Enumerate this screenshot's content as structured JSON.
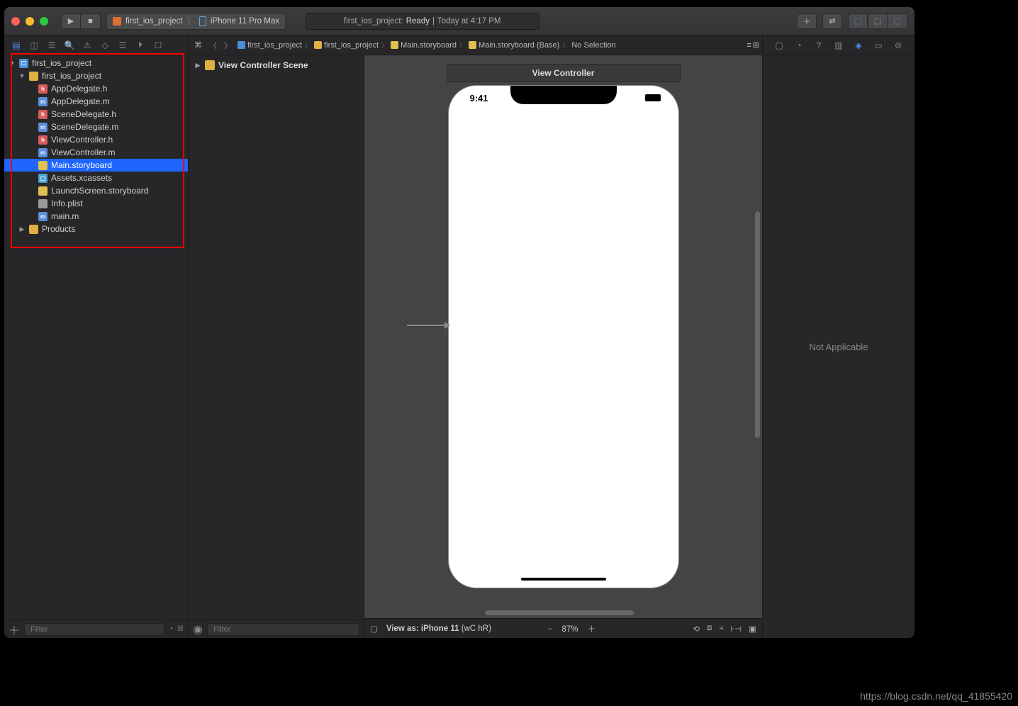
{
  "toolbar": {
    "scheme_project": "first_ios_project",
    "scheme_device": "iPhone 11 Pro Max"
  },
  "status": {
    "project": "first_ios_project:",
    "state": "Ready",
    "sep": " | ",
    "time": "Today at 4:17 PM"
  },
  "jumpbar": {
    "i1": "first_ios_project",
    "i2": "first_ios_project",
    "i3": "Main.storyboard",
    "i4": "Main.storyboard (Base)",
    "i5": "No Selection"
  },
  "navigator": {
    "project": "first_ios_project",
    "group": "first_ios_project",
    "files": {
      "f1": "AppDelegate.h",
      "f2": "AppDelegate.m",
      "f3": "SceneDelegate.h",
      "f4": "SceneDelegate.m",
      "f5": "ViewController.h",
      "f6": "ViewController.m",
      "f7": "Main.storyboard",
      "f8": "Assets.xcassets",
      "f9": "LaunchScreen.storyboard",
      "f10": "Info.plist",
      "f11": "main.m"
    },
    "products": "Products",
    "filter_placeholder": "Filter"
  },
  "outline": {
    "scene": "View Controller Scene",
    "filter_placeholder": "Filter"
  },
  "canvas": {
    "vc_title": "View Controller",
    "statusbar_time": "9:41",
    "footer_viewas_label": "View as: iPhone 11",
    "footer_traits": "(wC hR)",
    "zoom_pct": "87%"
  },
  "inspector": {
    "body_text": "Not Applicable"
  },
  "watermark": "https://blog.csdn.net/qq_41855420"
}
